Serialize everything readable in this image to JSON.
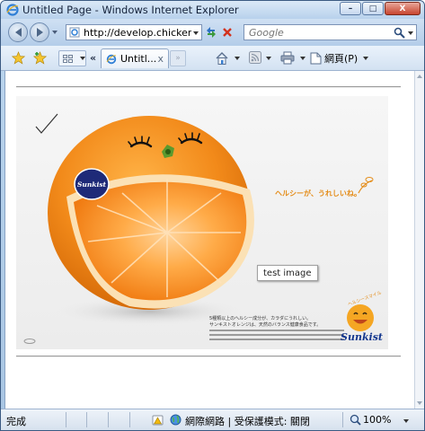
{
  "window": {
    "title": "Untitled Page - Windows Internet Explorer",
    "minimize_glyph": "–",
    "maximize_glyph": "□",
    "close_glyph": "X"
  },
  "address_bar": {
    "url": "http://develop.chicken-l"
  },
  "search": {
    "placeholder": "Google"
  },
  "tabs": [
    {
      "label": "Untitl...",
      "close_glyph": "x"
    }
  ],
  "toolbar": {
    "tab_scroll_glyph": "«",
    "new_tab_glyph": "»",
    "page_menu_label": "網頁(P)"
  },
  "page": {
    "ad": {
      "tagline": "ヘルシーが、うれしいね。",
      "body_line1": "5種類以上のヘルシー成分が、カラダにうれしい。",
      "body_line2": "サンキストオレンジは、天然のバランス健康食品です。",
      "smiley_caption": "ヘルシースマイル",
      "brand": "Sunkist",
      "sticker_brand": "Sunkist"
    },
    "alt_tooltip": "test image"
  },
  "statusbar": {
    "status": "完成",
    "zone": "網際網路 | 受保護模式: 關閉",
    "zoom": "100%"
  },
  "colors": {
    "orange": "#f28a1a",
    "brand_blue": "#12368e",
    "tagline_orange": "#e48b16"
  }
}
